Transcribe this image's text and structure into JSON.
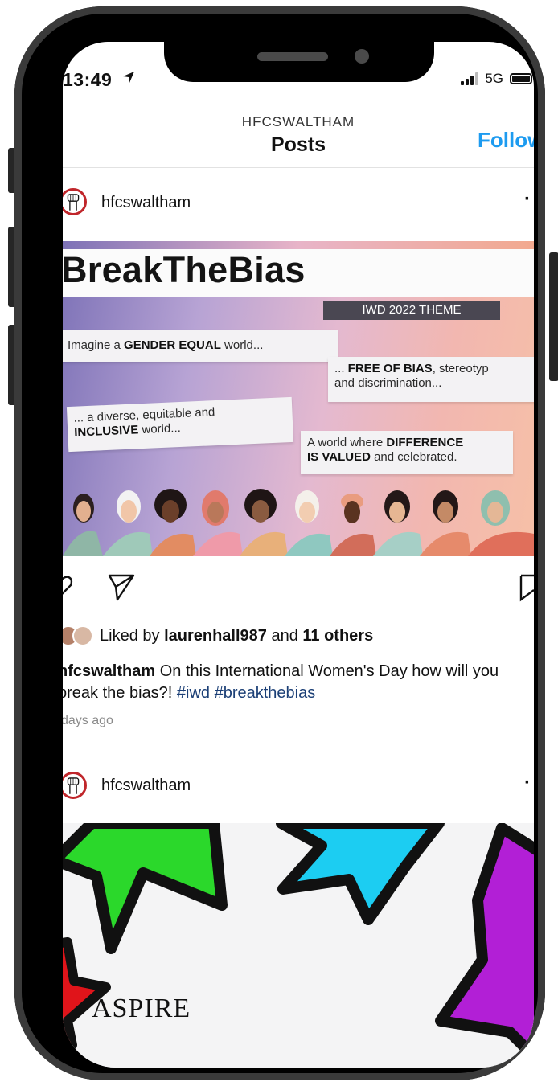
{
  "status_bar": {
    "time": "13:49",
    "network": "5G",
    "icons": [
      "location-arrow-icon",
      "signal-bars-icon",
      "battery-icon"
    ]
  },
  "header": {
    "account": "HFCSWALTHAM",
    "title": "Posts",
    "follow_label": "Follow"
  },
  "post1": {
    "username": "hfcswaltham",
    "more_icon": "more-dots-icon",
    "image": {
      "title": "BreakTheBias",
      "theme_label": "IWD 2022 THEME",
      "note1": {
        "pre": "Imagine a ",
        "bold": "GENDER EQUAL",
        "post": " world..."
      },
      "note2": {
        "pre": "... ",
        "bold": "FREE OF BIAS",
        "post": ", stereotyp",
        "line2": "and discrimination..."
      },
      "note3": {
        "line1": "... a diverse, equitable and",
        "bold": "INCLUSIVE",
        "post": " world..."
      },
      "note4": {
        "pre": "A world where ",
        "bold": "DIFFERENCE",
        "bold2": "IS VALUED",
        "post": " and celebrated."
      }
    },
    "likes": {
      "prefix": "Liked by ",
      "user": "laurenhall987",
      "middle": " and ",
      "others": "11 others"
    },
    "caption": {
      "user": "hfcswaltham",
      "text": " On this International Women's Day how will you break the bias?! ",
      "tag1": "#iwd",
      "tag2": "#breakthebias"
    },
    "time_ago": "days ago"
  },
  "post2": {
    "username": "hfcswaltham",
    "image_text": "ASPIRE"
  },
  "colors": {
    "accent": "#1d9bf0",
    "hashtag": "#1b3f76",
    "avatar_ring": "#c0262b",
    "star_green": "#2bd82b",
    "star_cyan": "#1ccdf2",
    "star_purple": "#b21fd6",
    "star_red": "#e0141a"
  }
}
